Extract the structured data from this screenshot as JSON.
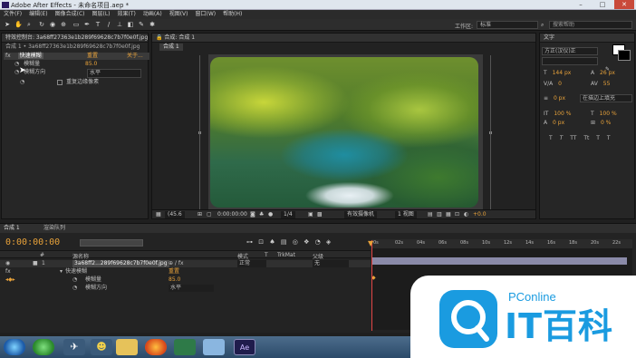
{
  "window": {
    "title": "Adobe After Effects - 未命名项目.aep *",
    "minimize": "–",
    "maximize": "□",
    "close": "✕"
  },
  "menu": [
    "文件(F)",
    "编辑(E)",
    "图像合成(C)",
    "图层(L)",
    "效果(T)",
    "动画(A)",
    "视图(V)",
    "窗口(W)",
    "帮助(H)"
  ],
  "toolbar": {
    "tools": [
      "select-icon",
      "hand-icon",
      "zoom-icon",
      "rotate-icon",
      "camera-icon",
      "pan-behind-icon",
      "rectangle-icon",
      "pen-icon",
      "text-icon",
      "brush-icon",
      "clone-icon",
      "eraser-icon",
      "roto-icon",
      "puppet-icon"
    ],
    "workspace_label": "工作区:",
    "workspace_value": "标准",
    "search_placeholder": "搜索帮助"
  },
  "effects_panel": {
    "tab": "特效控制台: 3a68ff27363e1b289f69628c7b7f0e0f.jpg",
    "subtitle": "合成 1 • 3a68ff27363e1b289f69628c7b7f0e0f.jpg",
    "effect_name": "快速模糊",
    "reset": "重置",
    "about": "关于...",
    "prop_blur": "模糊量",
    "prop_blur_value": "85.0",
    "prop_dir": "模糊方向",
    "prop_dir_value": "水平",
    "repeat_edges": "重复边缘像素"
  },
  "comp_panel": {
    "tab": "合成: 合成 1",
    "subtab": "合成 1",
    "zoom": "(45.6",
    "timecode": "0:00:00:00",
    "resolution": "1/4",
    "camera": "有效摄像机",
    "views": "1 视图",
    "offset": "+0.0"
  },
  "info_panel": {
    "tab": "文字",
    "font": "方正(汉仪)正",
    "size": "144 px",
    "leading": "26 px",
    "tracking": "0",
    "kerning": "55",
    "stroke": "0 px",
    "stroke_mode": "在描边上填充",
    "vscale": "100 %",
    "hscale": "100 %",
    "baseline": "0 px",
    "tsume": "0 %",
    "styles": [
      "T",
      "T",
      "TT",
      "Tt",
      "T",
      "T"
    ]
  },
  "timeline": {
    "tab1": "合成 1",
    "tab2": "渲染队列",
    "timecode": "0:00:00:00",
    "columns": [
      "#",
      "源名称",
      "模式",
      "T",
      "TrkMat",
      "父级"
    ],
    "layer_name": "3a68ff2...289f69628c7b7f0e0f.jpg",
    "layer_num": "1",
    "layer_mode": "正常",
    "parent": "无",
    "effect": "快速模糊",
    "reset": "重置",
    "prop_blur": "模糊量",
    "prop_blur_value": "85.0",
    "prop_dir": "模糊方向",
    "prop_dir_value": "水平",
    "ruler": [
      "0s",
      "02s",
      "04s",
      "06s",
      "08s",
      "10s",
      "12s",
      "14s",
      "16s",
      "18s",
      "20s",
      "22s",
      "10s"
    ]
  },
  "watermark": {
    "brand": "PConline",
    "text": "IT百科"
  },
  "colors": {
    "accent_orange": "#e8a23a",
    "accent_blue": "#5fa8e8",
    "playhead": "#e34545",
    "watermark_blue": "#1a9be0"
  }
}
